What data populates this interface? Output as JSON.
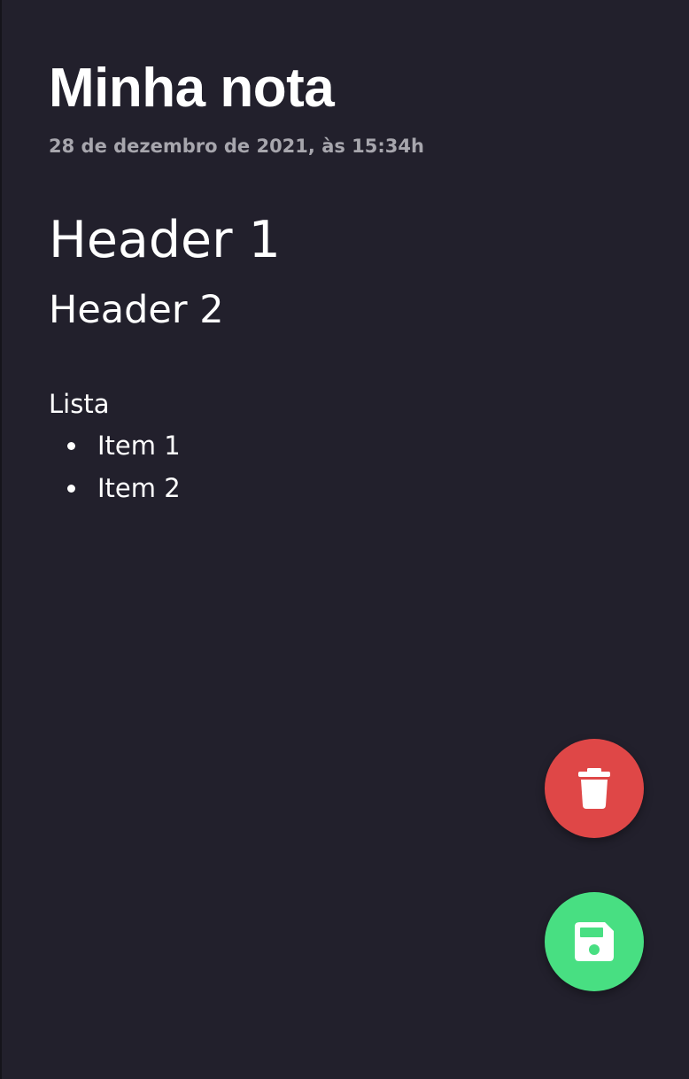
{
  "note": {
    "title": "Minha nota",
    "date": "28 de dezembro de 2021, às 15:34h",
    "header1": "Header 1",
    "header2": "Header 2",
    "list_label": "Lista",
    "list_items": [
      "Item 1",
      "Item 2"
    ]
  },
  "actions": {
    "delete": {
      "icon": "trash-icon",
      "color": "#df4747"
    },
    "save": {
      "icon": "floppy-disk-icon",
      "color": "#48df82"
    }
  },
  "theme": {
    "background": "#22202c",
    "text": "#ffffff",
    "muted": "#a7a6ad"
  }
}
